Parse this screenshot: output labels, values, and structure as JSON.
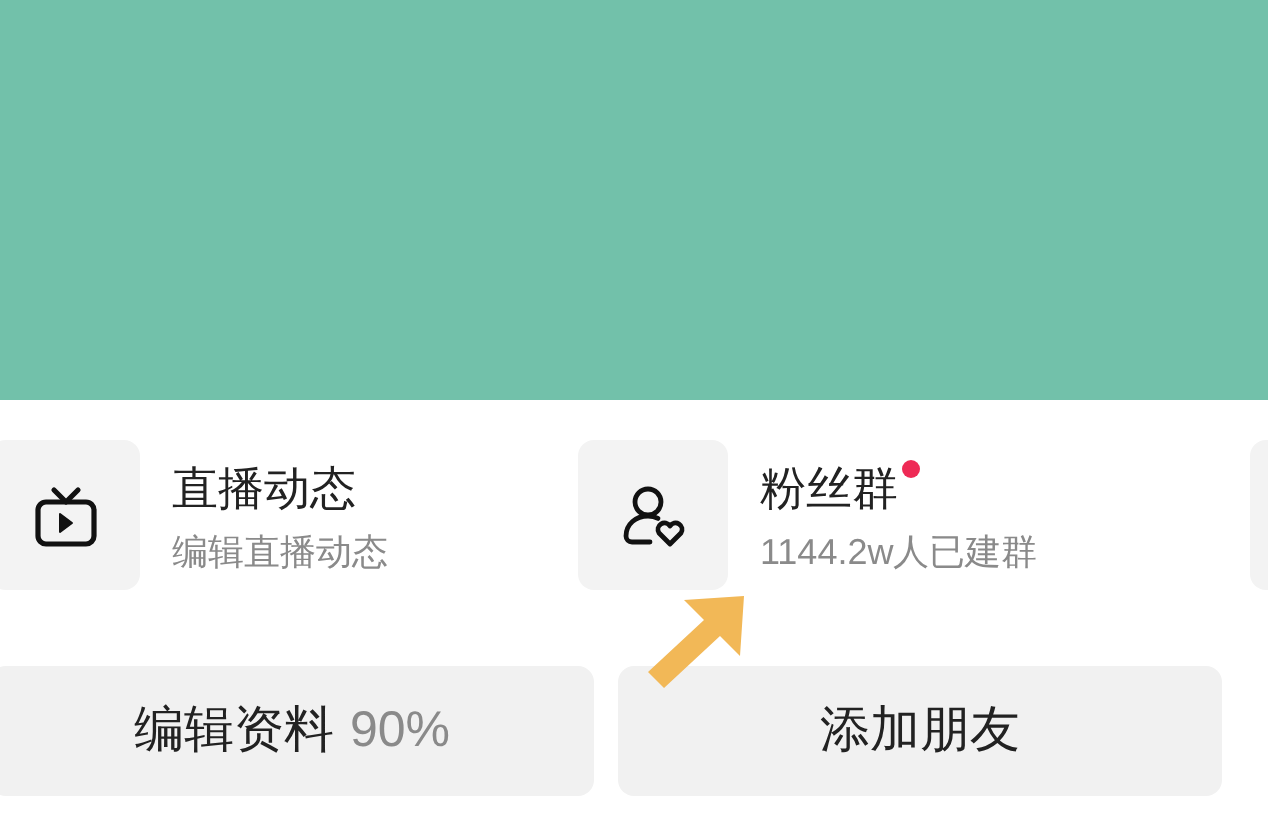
{
  "shortcuts": [
    {
      "kind": "tv",
      "title": "直播动态",
      "subtitle": "编辑直播动态",
      "badge": false
    },
    {
      "kind": "fans",
      "title": "粉丝群",
      "subtitle": "1144.2w人已建群",
      "badge": true
    }
  ],
  "buttons": [
    {
      "label": "编辑资料",
      "extra": "90%"
    },
    {
      "label": "添加朋友"
    }
  ]
}
